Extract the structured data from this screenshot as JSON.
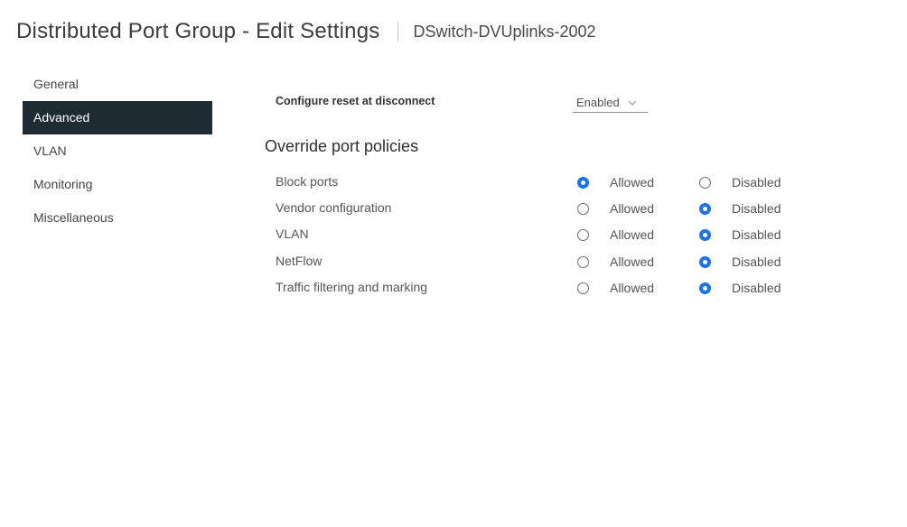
{
  "header": {
    "title": "Distributed Port Group - Edit Settings",
    "subtitle": "DSwitch-DVUplinks-2002"
  },
  "nav": {
    "items": [
      {
        "label": "General",
        "active": false
      },
      {
        "label": "Advanced",
        "active": true
      },
      {
        "label": "VLAN",
        "active": false
      },
      {
        "label": "Monitoring",
        "active": false
      },
      {
        "label": "Miscellaneous",
        "active": false
      }
    ]
  },
  "advanced": {
    "reset_at_disconnect": {
      "label": "Configure reset at disconnect",
      "value": "Enabled"
    },
    "override_heading": "Override port policies",
    "options": {
      "allowed": "Allowed",
      "disabled": "Disabled"
    },
    "policies": [
      {
        "label": "Block ports",
        "selected": "Allowed"
      },
      {
        "label": "Vendor configuration",
        "selected": "Disabled"
      },
      {
        "label": "VLAN",
        "selected": "Disabled"
      },
      {
        "label": "NetFlow",
        "selected": "Disabled"
      },
      {
        "label": "Traffic filtering and marking",
        "selected": "Disabled"
      }
    ]
  },
  "icons": {
    "select_chevron": "chevron-down-icon"
  },
  "colors": {
    "nav_active_bg": "#1f2b33",
    "radio_selected": "#1a73e8"
  }
}
